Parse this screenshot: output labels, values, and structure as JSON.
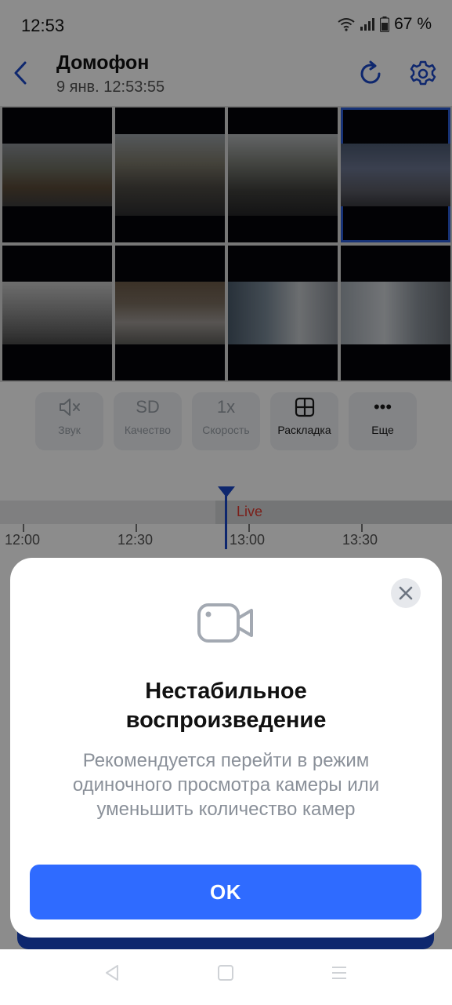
{
  "status": {
    "time": "12:53",
    "battery": "67 %",
    "icons": [
      "wifi-icon",
      "signal-icon",
      "battery-icon"
    ]
  },
  "header": {
    "title": "Домофон",
    "subtitle": "9 янв. 12:53:55",
    "icons": [
      "back-arrow-icon",
      "refresh-icon",
      "gear-icon"
    ]
  },
  "controls": [
    {
      "icon_text": "",
      "label": "Звук",
      "icon": "mute-speaker-icon"
    },
    {
      "icon_text": "SD",
      "label": "Качество",
      "icon": "quality-sd"
    },
    {
      "icon_text": "1x",
      "label": "Скорость",
      "icon": "speed-1x"
    },
    {
      "icon_text": "",
      "label": "Раскладка",
      "icon": "grid-layout-icon"
    },
    {
      "icon_text": "•••",
      "label": "Еще",
      "icon": "more-dots-icon"
    }
  ],
  "timeline": {
    "live_label": "Live",
    "ticks": [
      "12:00",
      "12:30",
      "13:00",
      "13:30"
    ]
  },
  "modal": {
    "title_line1": "Нестабильное",
    "title_line2": "воспроизведение",
    "text_line1": "Рекомендуется перейти в режим",
    "text_line2": "одиночного просмотра камеры или",
    "text_line3": "уменьшить количество камер",
    "ok_label": "OK",
    "icon": "video-camera-icon"
  },
  "colors": {
    "accent": "#2f6bff",
    "live": "#e03a2e",
    "selected_border": "#2a5bd7"
  }
}
